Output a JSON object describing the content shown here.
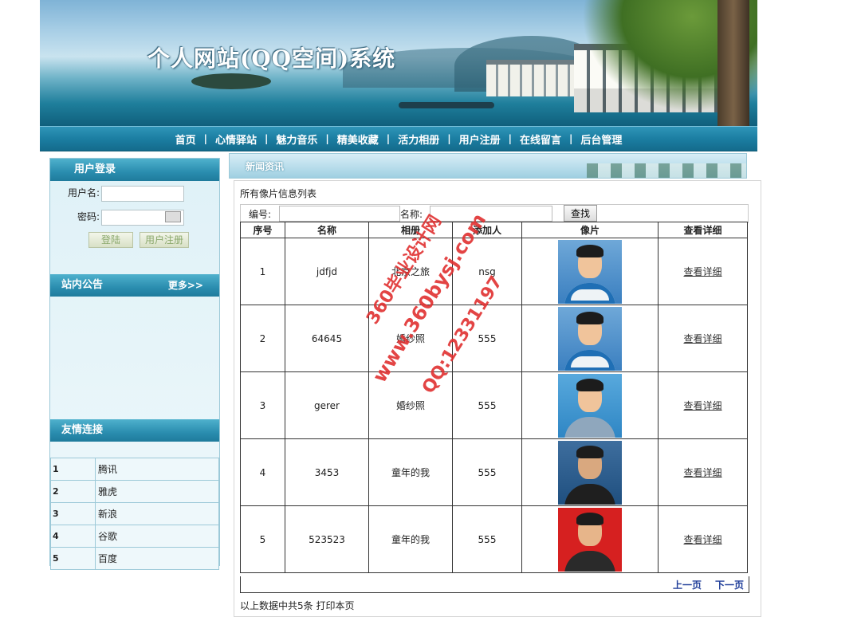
{
  "header": {
    "site_title": "个人网站(QQ空间)系统"
  },
  "nav": {
    "items": [
      "首页",
      "心情驿站",
      "魅力音乐",
      "精美收藏",
      "活力相册",
      "用户注册",
      "在线留言",
      "后台管理"
    ],
    "separator": "|"
  },
  "login": {
    "title": "用户登录",
    "username_label": "用户名:",
    "password_label": "密码:",
    "login_button": "登陆",
    "register_button": "用户注册"
  },
  "notice": {
    "title": "站内公告",
    "more": "更多>>"
  },
  "links": {
    "title": "友情连接",
    "items": [
      {
        "no": "1",
        "name": "腾讯"
      },
      {
        "no": "2",
        "name": "雅虎"
      },
      {
        "no": "3",
        "name": "新浪"
      },
      {
        "no": "4",
        "name": "谷歌"
      },
      {
        "no": "5",
        "name": "百度"
      }
    ]
  },
  "content": {
    "section_title": "新闻资讯",
    "list_caption": "所有像片信息列表",
    "search": {
      "id_label": "编号:",
      "name_label": "名称:",
      "button": "查找"
    },
    "columns": [
      "序号",
      "名称",
      "相册",
      "添加人",
      "像片",
      "查看详细"
    ],
    "rows": [
      {
        "no": "1",
        "name": "jdfjd",
        "album": "北京之旅",
        "adder": "nsg",
        "photo": "student-portrait-icon",
        "detail": "查看详细"
      },
      {
        "no": "2",
        "name": "64645",
        "album": "婚纱照",
        "adder": "555",
        "photo": "student-portrait-icon",
        "detail": "查看详细"
      },
      {
        "no": "3",
        "name": "gerer",
        "album": "婚纱照",
        "adder": "555",
        "photo": "uniform-portrait-icon",
        "detail": "查看详细"
      },
      {
        "no": "4",
        "name": "3453",
        "album": "童年的我",
        "adder": "555",
        "photo": "dark-jacket-portrait-icon",
        "detail": "查看详细"
      },
      {
        "no": "5",
        "name": "523523",
        "album": "童年的我",
        "adder": "555",
        "photo": "red-background-portrait-icon",
        "detail": "查看详细"
      }
    ],
    "pager": {
      "prev": "上一页",
      "next": "下一页"
    },
    "summary": "以上数据中共5条  打印本页"
  },
  "watermark": {
    "line1": "360毕业设计网",
    "line2": "www.360bysj.com",
    "line3": "QQ:12331197"
  },
  "colors": {
    "nav_bg": "#1b7ea2",
    "sidebar_head": "#2a8daf",
    "pager_link": "#1f3d99",
    "watermark": "#e03030"
  }
}
